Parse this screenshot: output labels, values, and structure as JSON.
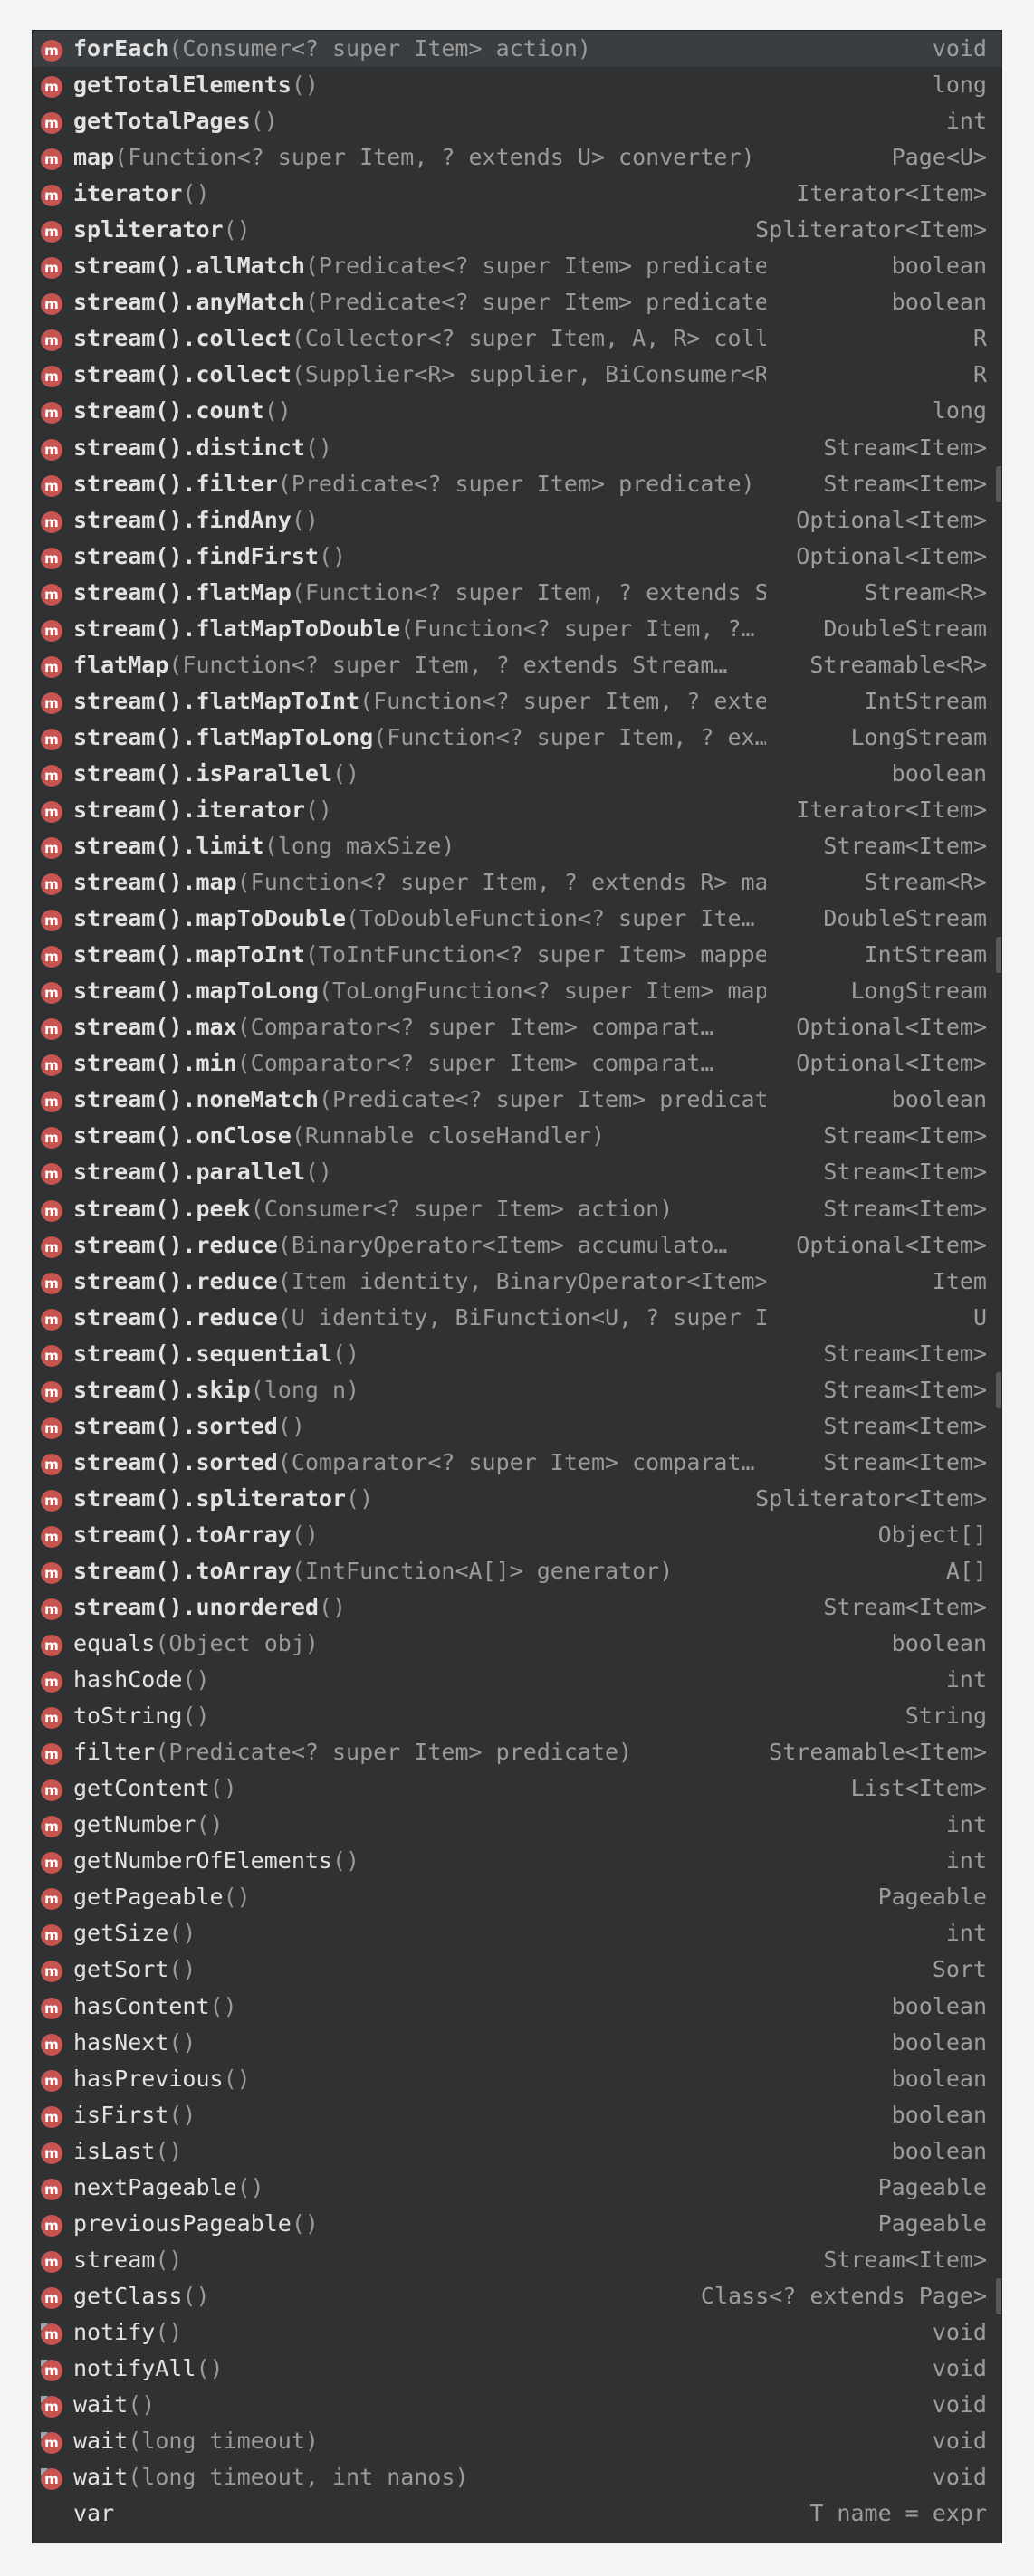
{
  "items": [
    {
      "name": "forEach",
      "params": "(Consumer<? super Item> action)",
      "type": "void",
      "bold": true,
      "icon": "method",
      "selected": true
    },
    {
      "name": "getTotalElements",
      "params": "()",
      "type": "long",
      "bold": true,
      "icon": "method"
    },
    {
      "name": "getTotalPages",
      "params": "()",
      "type": "int",
      "bold": true,
      "icon": "method"
    },
    {
      "name": "map",
      "params": "(Function<? super Item, ? extends U> converter)",
      "type": "Page<U>",
      "bold": true,
      "icon": "method"
    },
    {
      "name": "iterator",
      "params": "()",
      "type": "Iterator<Item>",
      "bold": true,
      "icon": "method"
    },
    {
      "name": "spliterator",
      "params": "()",
      "type": "Spliterator<Item>",
      "bold": true,
      "icon": "method"
    },
    {
      "name": "stream().allMatch",
      "params": "(Predicate<? super Item> predicate)",
      "type": "boolean",
      "bold": true,
      "icon": "method"
    },
    {
      "name": "stream().anyMatch",
      "params": "(Predicate<? super Item> predicate)",
      "type": "boolean",
      "bold": true,
      "icon": "method"
    },
    {
      "name": "stream().collect",
      "params": "(Collector<? super Item, A, R> collector)",
      "type": "R",
      "bold": true,
      "icon": "method"
    },
    {
      "name": "stream().collect",
      "params": "(Supplier<R> supplier, BiConsumer<R, ? supe…",
      "type": "R",
      "bold": true,
      "icon": "method"
    },
    {
      "name": "stream().count",
      "params": "()",
      "type": "long",
      "bold": true,
      "icon": "method"
    },
    {
      "name": "stream().distinct",
      "params": "()",
      "type": "Stream<Item>",
      "bold": true,
      "icon": "method"
    },
    {
      "name": "stream().filter",
      "params": "(Predicate<? super Item> predicate)",
      "type": "Stream<Item>",
      "bold": true,
      "icon": "method"
    },
    {
      "name": "stream().findAny",
      "params": "()",
      "type": "Optional<Item>",
      "bold": true,
      "icon": "method"
    },
    {
      "name": "stream().findFirst",
      "params": "()",
      "type": "Optional<Item>",
      "bold": true,
      "icon": "method"
    },
    {
      "name": "stream().flatMap",
      "params": "(Function<? super Item, ? extends S…",
      "type": "Stream<R>",
      "bold": true,
      "icon": "method"
    },
    {
      "name": "stream().flatMapToDouble",
      "params": "(Function<? super Item, ?…",
      "type": "DoubleStream",
      "bold": true,
      "icon": "method"
    },
    {
      "name": "flatMap",
      "params": "(Function<? super Item, ? extends Stream…",
      "type": "Streamable<R>",
      "bold": true,
      "icon": "method"
    },
    {
      "name": "stream().flatMapToInt",
      "params": "(Function<? super Item, ? exte…",
      "type": "IntStream",
      "bold": true,
      "icon": "method"
    },
    {
      "name": "stream().flatMapToLong",
      "params": "(Function<? super Item, ? ex…",
      "type": "LongStream",
      "bold": true,
      "icon": "method"
    },
    {
      "name": "stream().isParallel",
      "params": "()",
      "type": "boolean",
      "bold": true,
      "icon": "method"
    },
    {
      "name": "stream().iterator",
      "params": "()",
      "type": "Iterator<Item>",
      "bold": true,
      "icon": "method"
    },
    {
      "name": "stream().limit",
      "params": "(long maxSize)",
      "type": "Stream<Item>",
      "bold": true,
      "icon": "method"
    },
    {
      "name": "stream().map",
      "params": "(Function<? super Item, ? extends R> ma…",
      "type": "Stream<R>",
      "bold": true,
      "icon": "method"
    },
    {
      "name": "stream().mapToDouble",
      "params": "(ToDoubleFunction<? super Ite…",
      "type": "DoubleStream",
      "bold": true,
      "icon": "method"
    },
    {
      "name": "stream().mapToInt",
      "params": "(ToIntFunction<? super Item> mappe…",
      "type": "IntStream",
      "bold": true,
      "icon": "method"
    },
    {
      "name": "stream().mapToLong",
      "params": "(ToLongFunction<? super Item> map…",
      "type": "LongStream",
      "bold": true,
      "icon": "method"
    },
    {
      "name": "stream().max",
      "params": "(Comparator<? super Item> comparat…",
      "type": "Optional<Item>",
      "bold": true,
      "icon": "method"
    },
    {
      "name": "stream().min",
      "params": "(Comparator<? super Item> comparat…",
      "type": "Optional<Item>",
      "bold": true,
      "icon": "method"
    },
    {
      "name": "stream().noneMatch",
      "params": "(Predicate<? super Item> predicate)",
      "type": "boolean",
      "bold": true,
      "icon": "method"
    },
    {
      "name": "stream().onClose",
      "params": "(Runnable closeHandler)",
      "type": "Stream<Item>",
      "bold": true,
      "icon": "method"
    },
    {
      "name": "stream().parallel",
      "params": "()",
      "type": "Stream<Item>",
      "bold": true,
      "icon": "method"
    },
    {
      "name": "stream().peek",
      "params": "(Consumer<? super Item> action)",
      "type": "Stream<Item>",
      "bold": true,
      "icon": "method"
    },
    {
      "name": "stream().reduce",
      "params": "(BinaryOperator<Item> accumulato…",
      "type": "Optional<Item>",
      "bold": true,
      "icon": "method"
    },
    {
      "name": "stream().reduce",
      "params": "(Item identity, BinaryOperator<Item> accum…",
      "type": "Item",
      "bold": true,
      "icon": "method"
    },
    {
      "name": "stream().reduce",
      "params": "(U identity, BiFunction<U, ? super Item, U> …",
      "type": "U",
      "bold": true,
      "icon": "method"
    },
    {
      "name": "stream().sequential",
      "params": "()",
      "type": "Stream<Item>",
      "bold": true,
      "icon": "method"
    },
    {
      "name": "stream().skip",
      "params": "(long n)",
      "type": "Stream<Item>",
      "bold": true,
      "icon": "method"
    },
    {
      "name": "stream().sorted",
      "params": "()",
      "type": "Stream<Item>",
      "bold": true,
      "icon": "method"
    },
    {
      "name": "stream().sorted",
      "params": "(Comparator<? super Item> comparat…",
      "type": "Stream<Item>",
      "bold": true,
      "icon": "method"
    },
    {
      "name": "stream().spliterator",
      "params": "()",
      "type": "Spliterator<Item>",
      "bold": true,
      "icon": "method"
    },
    {
      "name": "stream().toArray",
      "params": "()",
      "type": "Object[]",
      "bold": true,
      "icon": "method"
    },
    {
      "name": "stream().toArray",
      "params": "(IntFunction<A[]> generator)",
      "type": "A[]",
      "bold": true,
      "icon": "method"
    },
    {
      "name": "stream().unordered",
      "params": "()",
      "type": "Stream<Item>",
      "bold": true,
      "icon": "method"
    },
    {
      "name": "equals",
      "params": "(Object obj)",
      "type": "boolean",
      "bold": false,
      "icon": "method"
    },
    {
      "name": "hashCode",
      "params": "()",
      "type": "int",
      "bold": false,
      "icon": "method"
    },
    {
      "name": "toString",
      "params": "()",
      "type": "String",
      "bold": false,
      "icon": "method"
    },
    {
      "name": "filter",
      "params": "(Predicate<? super Item> predicate)",
      "type": "Streamable<Item>",
      "bold": false,
      "icon": "method"
    },
    {
      "name": "getContent",
      "params": "()",
      "type": "List<Item>",
      "bold": false,
      "icon": "method"
    },
    {
      "name": "getNumber",
      "params": "()",
      "type": "int",
      "bold": false,
      "icon": "method"
    },
    {
      "name": "getNumberOfElements",
      "params": "()",
      "type": "int",
      "bold": false,
      "icon": "method"
    },
    {
      "name": "getPageable",
      "params": "()",
      "type": "Pageable",
      "bold": false,
      "icon": "method"
    },
    {
      "name": "getSize",
      "params": "()",
      "type": "int",
      "bold": false,
      "icon": "method"
    },
    {
      "name": "getSort",
      "params": "()",
      "type": "Sort",
      "bold": false,
      "icon": "method"
    },
    {
      "name": "hasContent",
      "params": "()",
      "type": "boolean",
      "bold": false,
      "icon": "method"
    },
    {
      "name": "hasNext",
      "params": "()",
      "type": "boolean",
      "bold": false,
      "icon": "method"
    },
    {
      "name": "hasPrevious",
      "params": "()",
      "type": "boolean",
      "bold": false,
      "icon": "method"
    },
    {
      "name": "isFirst",
      "params": "()",
      "type": "boolean",
      "bold": false,
      "icon": "method"
    },
    {
      "name": "isLast",
      "params": "()",
      "type": "boolean",
      "bold": false,
      "icon": "method"
    },
    {
      "name": "nextPageable",
      "params": "()",
      "type": "Pageable",
      "bold": false,
      "icon": "method"
    },
    {
      "name": "previousPageable",
      "params": "()",
      "type": "Pageable",
      "bold": false,
      "icon": "method"
    },
    {
      "name": "stream",
      "params": "()",
      "type": "Stream<Item>",
      "bold": false,
      "icon": "method"
    },
    {
      "name": "getClass",
      "params": "()",
      "type": "Class<? extends Page>",
      "bold": false,
      "icon": "method"
    },
    {
      "name": "notify",
      "params": "()",
      "type": "void",
      "bold": false,
      "icon": "method-final"
    },
    {
      "name": "notifyAll",
      "params": "()",
      "type": "void",
      "bold": false,
      "icon": "method-final"
    },
    {
      "name": "wait",
      "params": "()",
      "type": "void",
      "bold": false,
      "icon": "method-final"
    },
    {
      "name": "wait",
      "params": "(long timeout)",
      "type": "void",
      "bold": false,
      "icon": "method-final"
    },
    {
      "name": "wait",
      "params": "(long timeout, int nanos)",
      "type": "void",
      "bold": false,
      "icon": "method-final"
    },
    {
      "name": "var",
      "params": "",
      "type": "T name = expr",
      "bold": false,
      "icon": "none"
    }
  ],
  "scroll_indicator_rows": [
    12,
    25,
    37,
    62
  ],
  "colors": {
    "background": "#2f3133",
    "selected_row": "#3b3e41",
    "icon_method": "#c75450",
    "icon_text": "#ffffff",
    "name": "#e2e2e2",
    "params": "#9a9a9a",
    "type": "#9d9d9d"
  }
}
